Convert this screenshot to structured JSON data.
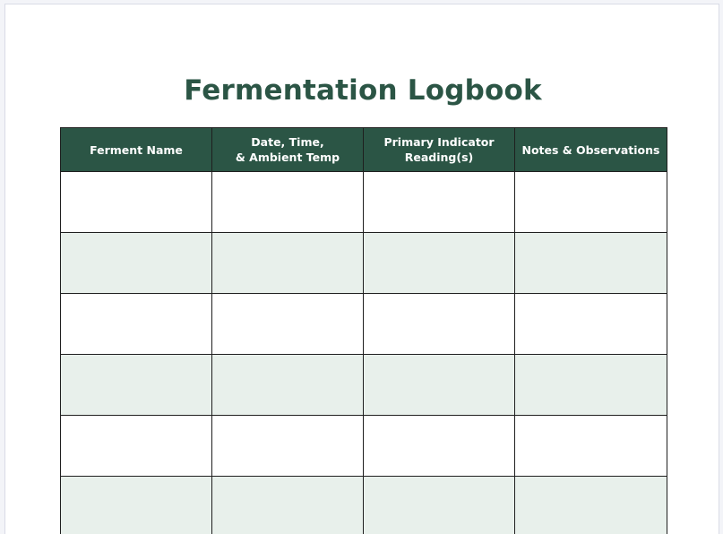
{
  "document": {
    "title": "Fermentation Logbook",
    "header_color": "#2b5545",
    "stripe_color": "#e8f0eb"
  },
  "table": {
    "columns": [
      "Ferment Name",
      "Date, Time,\n& Ambient Temp",
      "Primary Indicator\nReading(s)",
      "Notes & Observations"
    ],
    "rows": [
      [
        "",
        "",
        "",
        ""
      ],
      [
        "",
        "",
        "",
        ""
      ],
      [
        "",
        "",
        "",
        ""
      ],
      [
        "",
        "",
        "",
        ""
      ],
      [
        "",
        "",
        "",
        ""
      ],
      [
        "",
        "",
        "",
        ""
      ]
    ]
  }
}
